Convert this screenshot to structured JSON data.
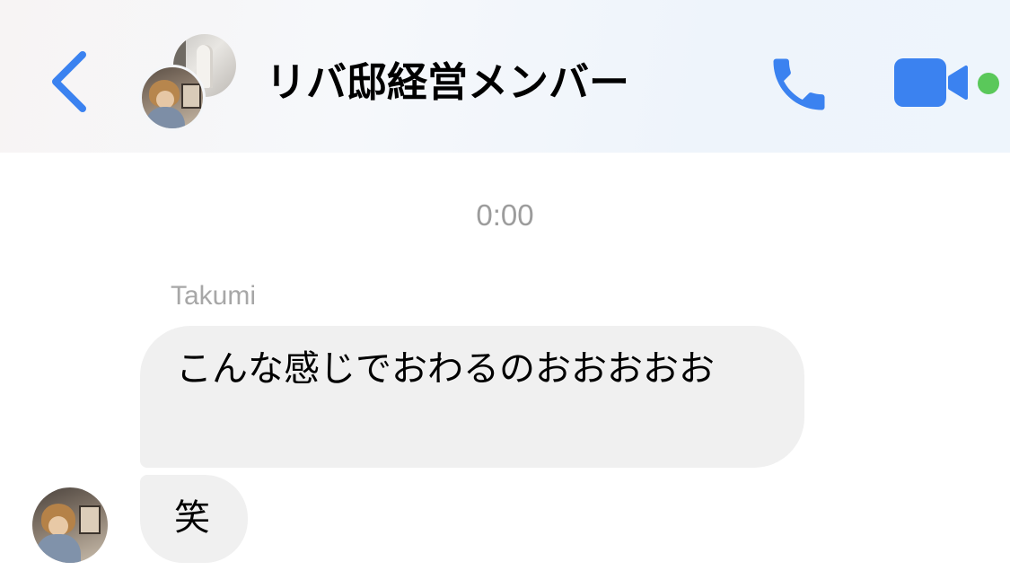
{
  "header": {
    "title": "リバ邸経営メンバー",
    "accent_color": "#3b82f0",
    "online_color": "#5ac85a",
    "icons": {
      "back": "chevron-left-icon",
      "call": "phone-icon",
      "video": "video-camera-icon"
    }
  },
  "conversation": {
    "timestamp": "0:00",
    "sender_name": "Takumi",
    "messages": [
      {
        "text": "こんな感じでおわるのおおおおお"
      },
      {
        "text": "笑"
      }
    ]
  }
}
